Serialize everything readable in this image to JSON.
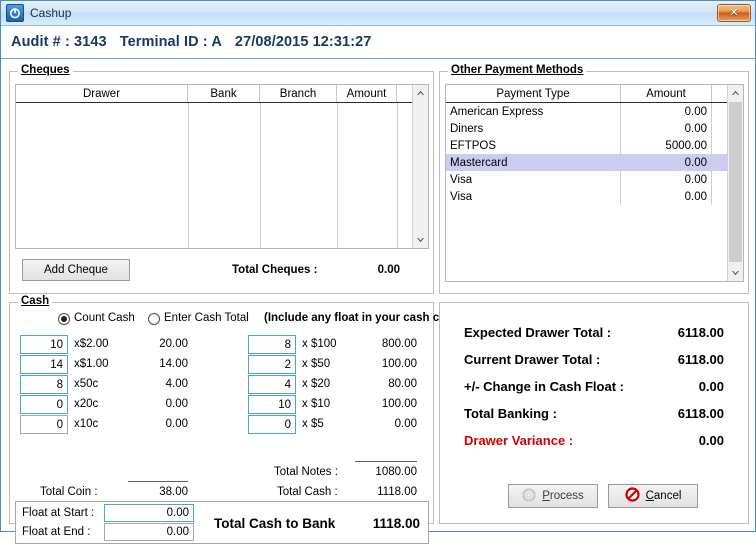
{
  "window": {
    "title": "Cashup",
    "app_icon": "power-icon",
    "close_label": "✕"
  },
  "header": {
    "audit_label": "Audit # : 3143",
    "terminal_label": "Terminal ID : A",
    "datetime": "27/08/2015 12:31:27"
  },
  "cheques": {
    "legend": "Cheques",
    "columns": [
      "Drawer",
      "Bank",
      "Branch",
      "Amount"
    ],
    "rows": [],
    "add_button": "Add Cheque",
    "total_label": "Total Cheques :",
    "total_value": "0.00",
    "scroll_up": "▲",
    "scroll_down": "▼"
  },
  "other_payments": {
    "legend": "Other Payment Methods",
    "columns": [
      "Payment Type",
      "Amount"
    ],
    "rows": [
      {
        "type": "American Express",
        "amount": "0.00",
        "selected": false
      },
      {
        "type": "Diners",
        "amount": "0.00",
        "selected": false
      },
      {
        "type": "EFTPOS",
        "amount": "5000.00",
        "selected": false
      },
      {
        "type": "Mastercard",
        "amount": "0.00",
        "selected": true
      },
      {
        "type": "Visa",
        "amount": "0.00",
        "selected": false
      },
      {
        "type": "Visa",
        "amount": "0.00",
        "selected": false
      }
    ],
    "scroll_up": "▲",
    "scroll_down": "▼"
  },
  "cash": {
    "legend": "Cash",
    "mode_count_label": "Count Cash",
    "mode_total_label": "Enter Cash Total",
    "mode_selected": "count",
    "note_hint": "(Include any float in your cash count)",
    "coins": [
      {
        "qty": "10",
        "denom": "x$2.00",
        "value": "20.00"
      },
      {
        "qty": "14",
        "denom": "x$1.00",
        "value": "14.00"
      },
      {
        "qty": "8",
        "denom": "x50c",
        "value": "4.00"
      },
      {
        "qty": "0",
        "denom": "x20c",
        "value": "0.00"
      },
      {
        "qty": "0",
        "denom": "x10c",
        "value": "0.00"
      }
    ],
    "notes": [
      {
        "qty": "8",
        "denom": "x  $100",
        "value": "800.00"
      },
      {
        "qty": "2",
        "denom": "x  $50",
        "value": "100.00"
      },
      {
        "qty": "4",
        "denom": "x  $20",
        "value": "80.00"
      },
      {
        "qty": "10",
        "denom": "x  $10",
        "value": "100.00"
      },
      {
        "qty": "0",
        "denom": "x  $5",
        "value": "0.00"
      }
    ],
    "total_coin_label": "Total Coin :",
    "total_coin_value": "38.00",
    "total_notes_label": "Total Notes :",
    "total_notes_value": "1080.00",
    "total_cash_label": "Total Cash :",
    "total_cash_value": "1118.00",
    "float_start_label": "Float at Start :",
    "float_start_value": "0.00",
    "float_end_label": "Float at End :",
    "float_end_value": "0.00",
    "total_bank_label": "Total Cash to Bank",
    "total_bank_value": "1118.00"
  },
  "summary": {
    "rows": [
      {
        "label": "Expected Drawer Total :",
        "value": "6118.00",
        "red": false
      },
      {
        "label": "Current Drawer Total :",
        "value": "6118.00",
        "red": false
      },
      {
        "label": "+/- Change in Cash Float :",
        "value": "0.00",
        "red": false
      },
      {
        "label": "Total Banking :",
        "value": "6118.00",
        "red": false
      },
      {
        "label": "Drawer Variance :",
        "value": "0.00",
        "red": true
      }
    ],
    "process_label": "Process",
    "process_accesskey": "P",
    "cancel_label": "Cancel",
    "cancel_accesskey": "C",
    "process_enabled": false
  },
  "colors": {
    "accent": "#4b8ec4",
    "selection": "#ccccf2",
    "variance_red": "#d40000",
    "header_text": "#1b3864"
  }
}
